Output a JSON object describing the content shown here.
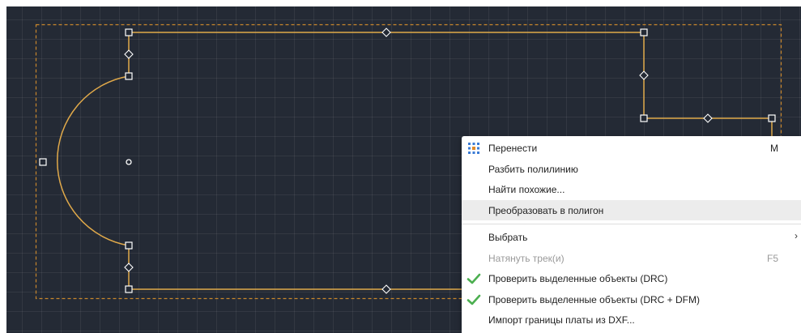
{
  "canvas": {
    "background": "#242a35",
    "outline_color": "#e0a94a",
    "selection_color": "#c8862c"
  },
  "context_menu": {
    "items": [
      {
        "label": "Перенести",
        "shortcut": "M",
        "icon": "move-icon"
      },
      {
        "label": "Разбить полилинию"
      },
      {
        "label": "Найти похожие..."
      },
      {
        "label": "Преобразовать в полигон",
        "highlighted": true
      },
      {
        "label": "Выбрать",
        "submenu_arrow": "›"
      },
      {
        "label": "Натянуть трек(и)",
        "shortcut": "F5",
        "disabled": true
      },
      {
        "label": "Проверить выделенные объекты (DRC)",
        "icon": "checkmark-icon"
      },
      {
        "label": "Проверить выделенные объекты (DRC + DFM)",
        "icon": "checkmark-icon"
      },
      {
        "label": "Импорт границы платы из DXF..."
      }
    ]
  }
}
